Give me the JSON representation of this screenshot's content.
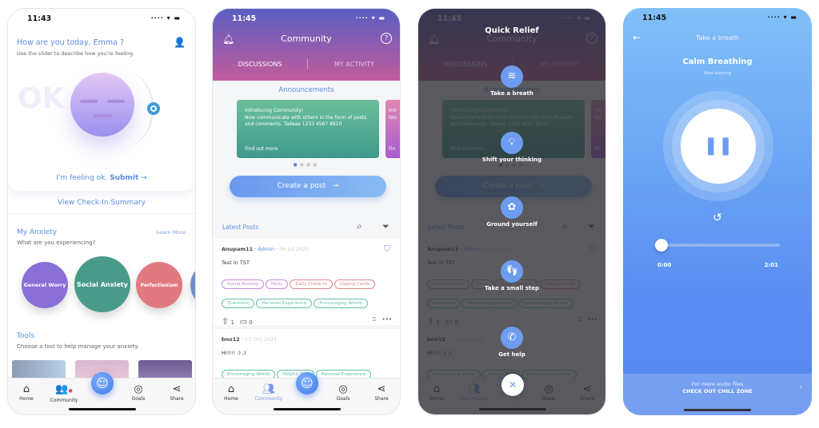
{
  "screen1": {
    "time": "11:43",
    "greeting": "How are you today, Emma ?",
    "subtitle": "Use the slider to describe how you're feeling.",
    "mood_word": "OK",
    "feeling": "I'm feeling ok.",
    "submit": "Submit",
    "summary_link": "View Check-In Summary",
    "anxiety_title": "My Anxiety",
    "learn_more": "Learn More",
    "anxiety_subtitle": "What are you experiencing?",
    "anxiety_items": [
      {
        "label": "General Worry",
        "color": "#8a6fd8"
      },
      {
        "label": "Social Anxiety",
        "color": "#4a9a8a"
      },
      {
        "label": "Perfectionism",
        "color": "#e07a80"
      }
    ],
    "tools_title": "Tools",
    "tools_subtitle": "Choose a tool to help manage your anxiety."
  },
  "nav": {
    "home": "Home",
    "community": "Community",
    "goals": "Goals",
    "share": "Share"
  },
  "community": {
    "time": "11:45",
    "title": "Community",
    "tab_discussions": "DISCUSSIONS",
    "tab_activity": "MY ACTIVITY",
    "announcements": "Announcements",
    "card_text": "Introducing Community!\nNow communicate with others in the form of posts and comments. Tadaaa 1233 4567 8910",
    "card_link": "Find out more",
    "card2_text": "Intr tim",
    "card2_link": "Fin",
    "create_post": "Create a post",
    "latest_posts": "Latest Posts",
    "post1": {
      "author": "Anupam11",
      "role": "Admin",
      "date": "06 Jul 2022",
      "text": "Test in TST",
      "tags": [
        {
          "label": "Social Anxiety",
          "color": "#c58ad8"
        },
        {
          "label": "Panic",
          "color": "#c58ad8"
        },
        {
          "label": "Daily Check-In",
          "color": "#e0848c"
        },
        {
          "label": "Coping Cards",
          "color": "#e0848c"
        },
        {
          "label": "Questions",
          "color": "#5ec0a8"
        },
        {
          "label": "Personal Experience",
          "color": "#5ec0a8"
        },
        {
          "label": "Encouraging Words",
          "color": "#5ec0a8"
        }
      ],
      "upvotes": "1",
      "comments": "0"
    },
    "post2": {
      "author": "bno12",
      "date": "13 Oct 2021",
      "text": "Hi!!!! :) ;)",
      "tags": [
        {
          "label": "Encouraging Words",
          "color": "#5ec0a8"
        },
        {
          "label": "Helpful Tips",
          "color": "#5ec0a8"
        },
        {
          "label": "Personal Experience",
          "color": "#5ec0a8"
        }
      ]
    }
  },
  "quick_relief": {
    "title": "Quick Relief",
    "items": [
      "Take a breath",
      "Shift your thinking",
      "Ground yourself",
      "Take a small step",
      "Get help"
    ]
  },
  "player": {
    "time": "11:45",
    "title": "Take a breath",
    "track": "Calm Breathing",
    "status": "Now playing",
    "elapsed": "0:00",
    "duration": "2:01",
    "progress": 0,
    "banner_line1": "For more audio files",
    "banner_line2": "CHECK OUT CHILL ZONE"
  }
}
